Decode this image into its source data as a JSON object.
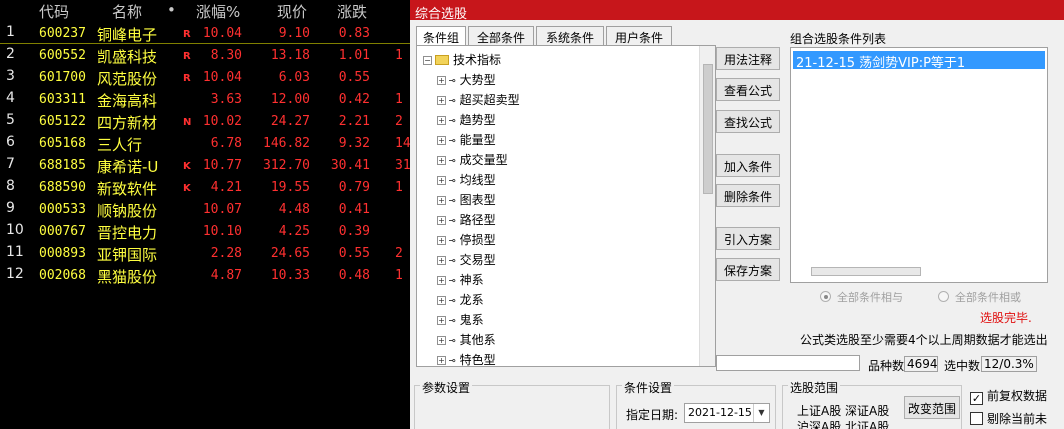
{
  "stock_table": {
    "headers": {
      "code": "代码",
      "name": "名称",
      "dot": "•",
      "change_pct": "涨幅%",
      "price": "现价",
      "change": "涨跌"
    },
    "rows": [
      {
        "no": "1",
        "code": "600237",
        "name": "铜峰电子",
        "flag": "R",
        "change_pct": "10.04",
        "price": "9.10",
        "change": "0.83",
        "extra": ""
      },
      {
        "no": "2",
        "code": "600552",
        "name": "凯盛科技",
        "flag": "R",
        "change_pct": "8.30",
        "price": "13.18",
        "change": "1.01",
        "extra": "1"
      },
      {
        "no": "3",
        "code": "601700",
        "name": "风范股份",
        "flag": "R",
        "change_pct": "10.04",
        "price": "6.03",
        "change": "0.55",
        "extra": ""
      },
      {
        "no": "4",
        "code": "603311",
        "name": "金海高科",
        "flag": "",
        "change_pct": "3.63",
        "price": "12.00",
        "change": "0.42",
        "extra": "1"
      },
      {
        "no": "5",
        "code": "605122",
        "name": "四方新材",
        "flag": "N",
        "change_pct": "10.02",
        "price": "24.27",
        "change": "2.21",
        "extra": "2"
      },
      {
        "no": "6",
        "code": "605168",
        "name": "三人行",
        "flag": "",
        "change_pct": "6.78",
        "price": "146.82",
        "change": "9.32",
        "extra": "14"
      },
      {
        "no": "7",
        "code": "688185",
        "name": "康希诺-U",
        "flag": "K",
        "change_pct": "10.77",
        "price": "312.70",
        "change": "30.41",
        "extra": "31"
      },
      {
        "no": "8",
        "code": "688590",
        "name": "新致软件",
        "flag": "K",
        "change_pct": "4.21",
        "price": "19.55",
        "change": "0.79",
        "extra": "1"
      },
      {
        "no": "9",
        "code": "000533",
        "name": "顺钠股份",
        "flag": "",
        "change_pct": "10.07",
        "price": "4.48",
        "change": "0.41",
        "extra": ""
      },
      {
        "no": "10",
        "code": "000767",
        "name": "晋控电力",
        "flag": "",
        "change_pct": "10.10",
        "price": "4.25",
        "change": "0.39",
        "extra": ""
      },
      {
        "no": "11",
        "code": "000893",
        "name": "亚钾国际",
        "flag": "",
        "change_pct": "2.28",
        "price": "24.65",
        "change": "0.55",
        "extra": "2"
      },
      {
        "no": "12",
        "code": "002068",
        "name": "黑猫股份",
        "flag": "",
        "change_pct": "4.87",
        "price": "10.33",
        "change": "0.48",
        "extra": "1"
      }
    ]
  },
  "dialog": {
    "title": "综合选股",
    "tabs": [
      "条件组",
      "全部条件",
      "系统条件",
      "用户条件"
    ],
    "tree_root": "技术指标",
    "tree_items": [
      "大势型",
      "超买超卖型",
      "趋势型",
      "能量型",
      "成交量型",
      "均线型",
      "图表型",
      "路径型",
      "停损型",
      "交易型",
      "神系",
      "龙系",
      "鬼系",
      "其他系",
      "特色型"
    ],
    "buttons": {
      "usage": "用法注释",
      "view_formula": "查看公式",
      "find_formula": "查找公式",
      "add_condition": "加入条件",
      "delete_condition": "删除条件",
      "import_plan": "引入方案",
      "save_plan": "保存方案",
      "change_range": "改变范围"
    },
    "condition_list_label": "组合选股条件列表",
    "condition_items": [
      "21-12-15 荡剑势VIP:P等于1"
    ],
    "radio_and": "全部条件相与",
    "radio_or": "全部条件相或",
    "status": "选股完毕.",
    "hint": "公式类选股至少需要4个以上周期数据才能选出",
    "count_label": "品种数",
    "count_value": "4694",
    "selected_label": "选中数",
    "selected_value": "12/0.3%",
    "param_group": "参数设置",
    "cond_group": "条件设置",
    "date_label": "指定日期:",
    "date_value": "2021-12-15",
    "range_group": "选股范围",
    "range_line1": "上证A股 深证A股",
    "range_line2": "沪深A股 北证A股",
    "check_adjust": "前复权数据",
    "check_adjust_mark": "✓",
    "check_remove": "剔除当前未"
  }
}
